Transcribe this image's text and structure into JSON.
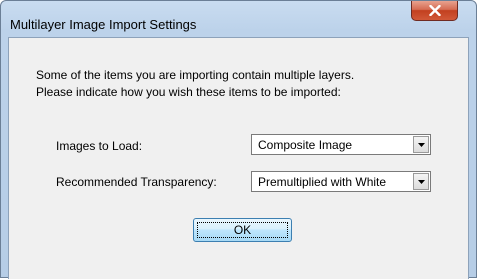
{
  "window": {
    "title": "Multilayer Image Import Settings"
  },
  "dialog": {
    "intro_line1": "Some of the items you are importing contain multiple layers.",
    "intro_line2": "Please indicate how you wish these items to be imported:",
    "images_to_load": {
      "label": "Images to Load:",
      "selected": "Composite Image"
    },
    "recommended_transparency": {
      "label": "Recommended Transparency:",
      "selected": "Premultiplied with White"
    },
    "ok_label": "OK"
  },
  "icons": {
    "close": "close-icon",
    "dropdown": "chevron-down-icon"
  },
  "colors": {
    "close_button": "#c2401f",
    "ok_button_border": "#3c7fb1"
  }
}
